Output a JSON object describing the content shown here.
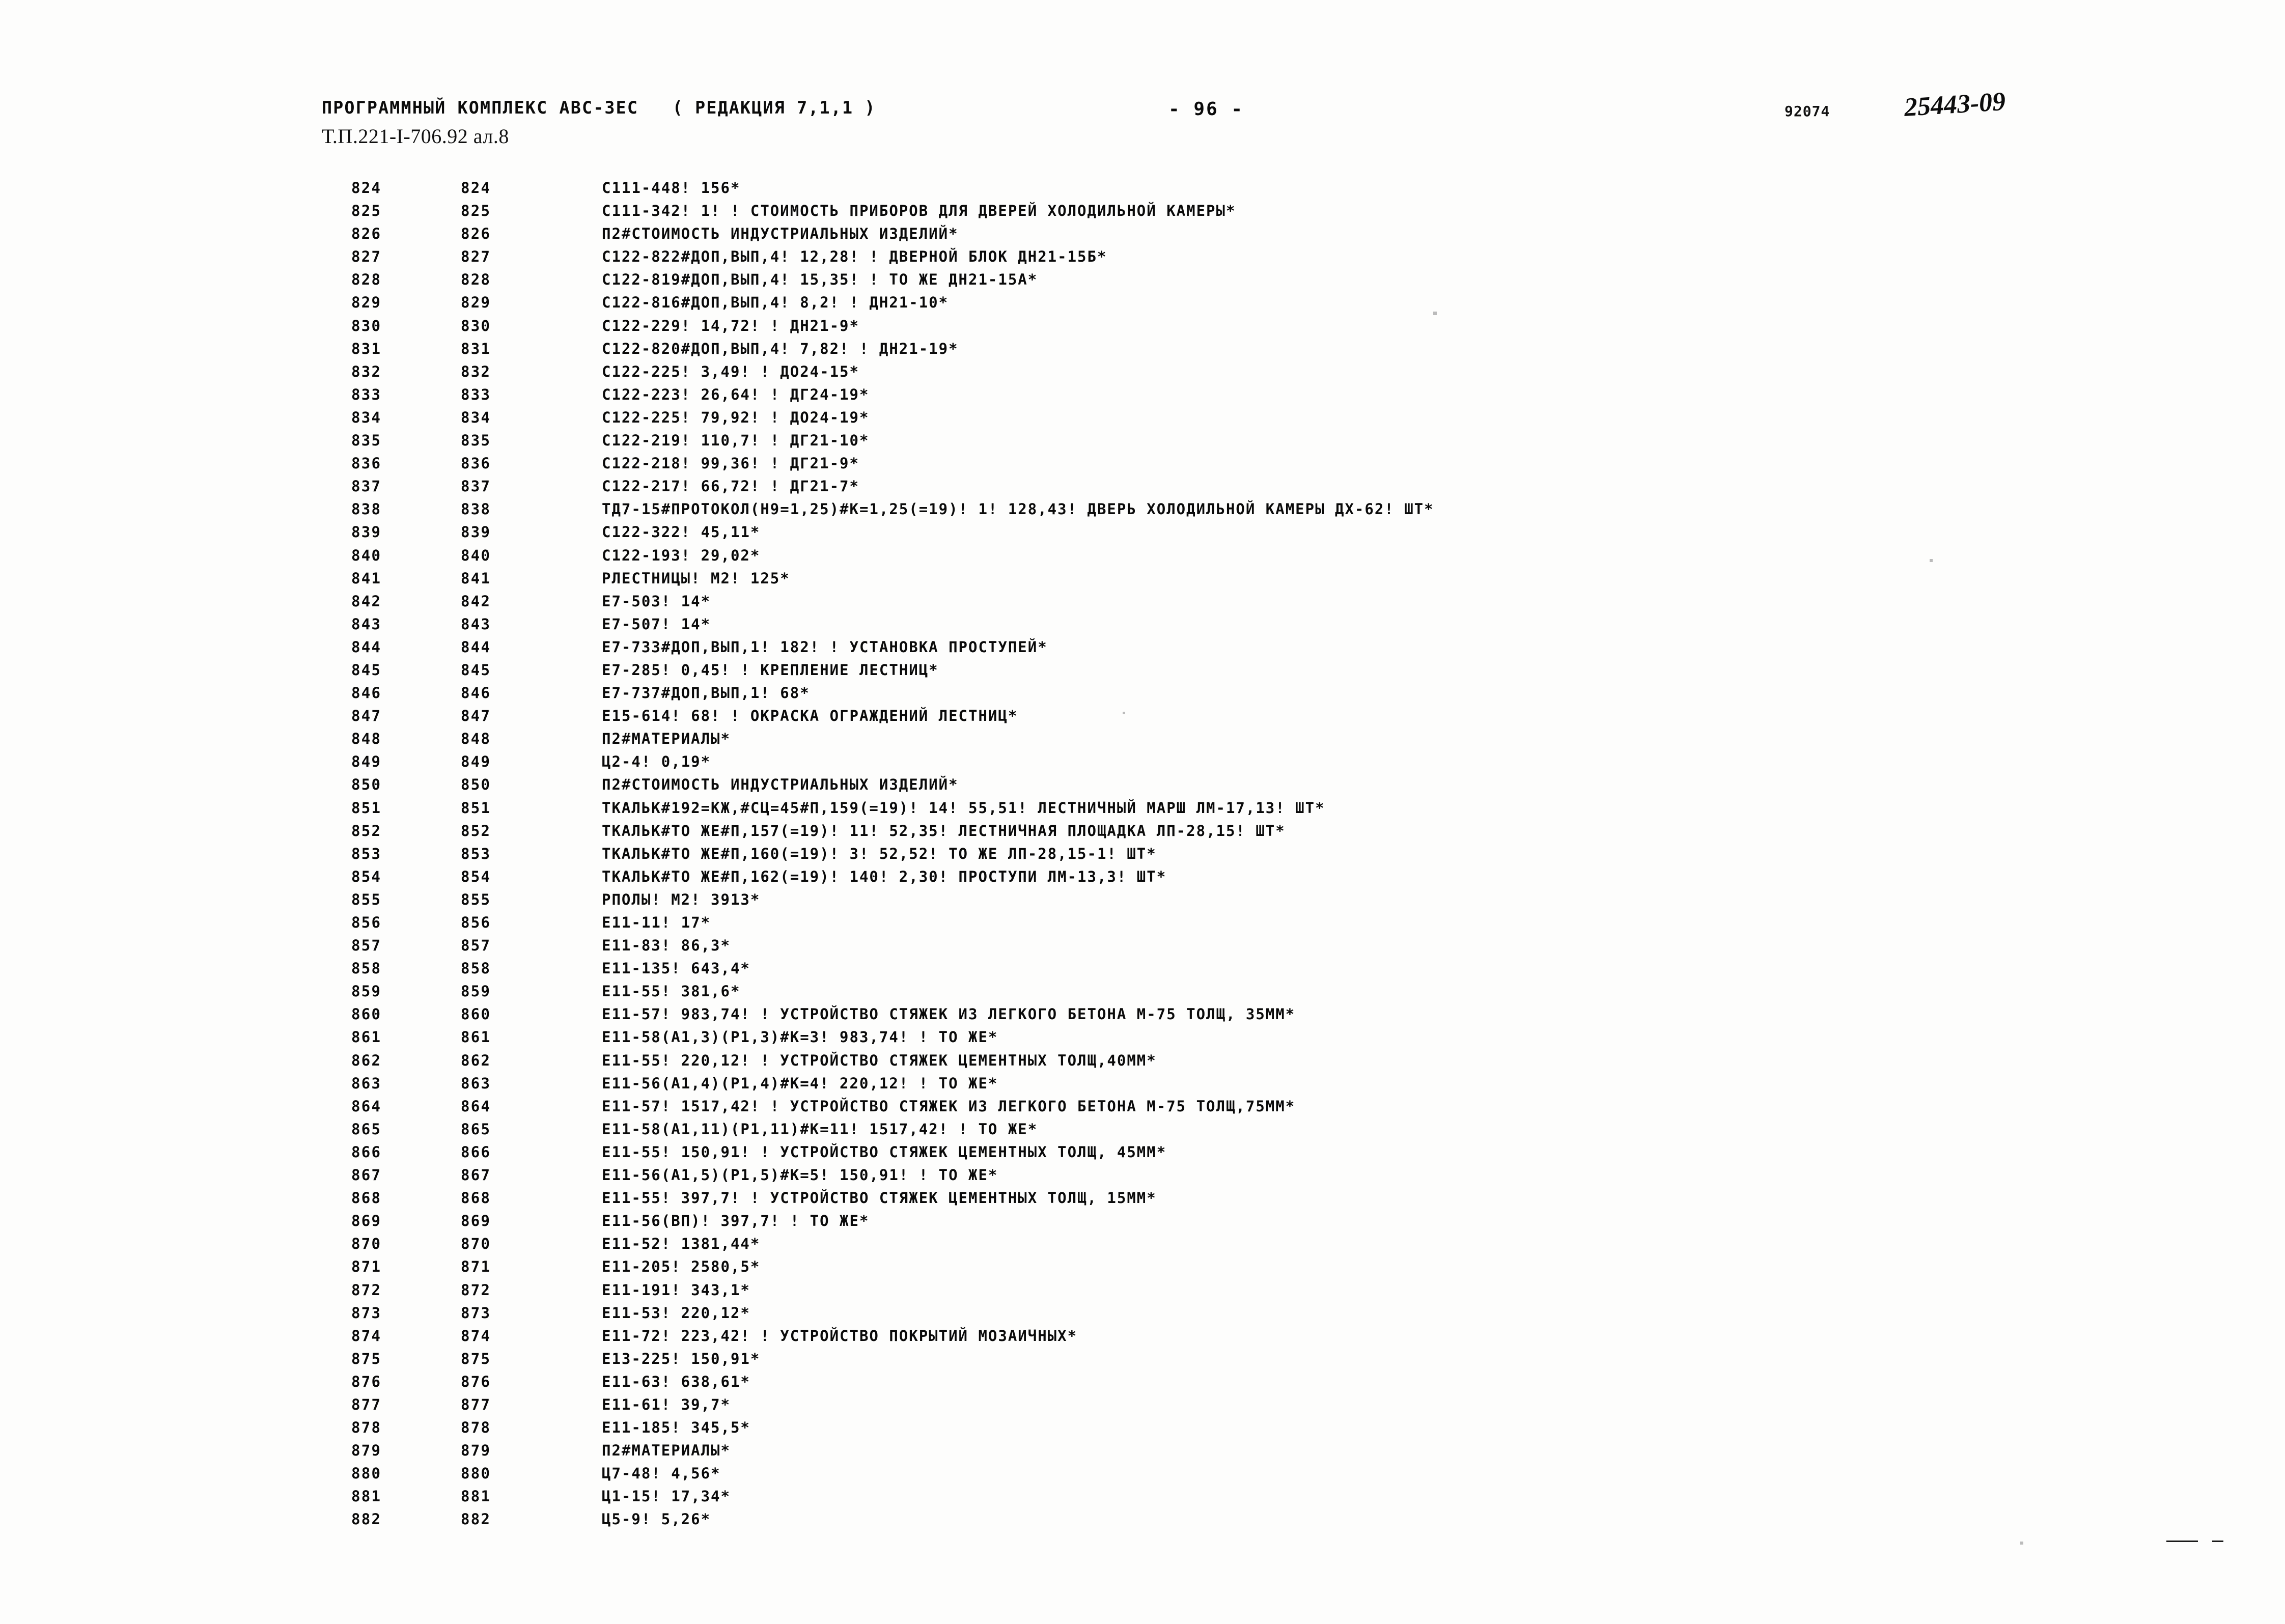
{
  "header": {
    "program_title": "ПРОГРАММНЫЙ КОМПЛЕКС АВС-ЗЕС   ( РЕДАКЦИЯ 7,1,1 )",
    "document_ref": "Т.П.221-I-706.92 ал.8",
    "page_marker": "- 96 -",
    "doc_code": "92074",
    "stamp": "25443-09"
  },
  "listing": {
    "rows": [
      {
        "a": "824",
        "b": "824",
        "text": "С111-448! 156*"
      },
      {
        "a": "825",
        "b": "825",
        "text": "С111-342! 1! ! СТОИМОСТЬ ПРИБОРОВ ДЛЯ ДВЕРЕЙ ХОЛОДИЛЬНОЙ КАМЕРЫ*"
      },
      {
        "a": "826",
        "b": "826",
        "text": "П2#СТОИМОСТЬ ИНДУСТРИАЛЬНЫХ ИЗДЕЛИЙ*"
      },
      {
        "a": "827",
        "b": "827",
        "text": "С122-822#ДОП,ВЫП,4! 12,28! ! ДВЕРНОЙ БЛОК ДН21-15Б*"
      },
      {
        "a": "828",
        "b": "828",
        "text": "С122-819#ДОП,ВЫП,4! 15,35! ! ТО ЖЕ ДН21-15А*"
      },
      {
        "a": "829",
        "b": "829",
        "text": "С122-816#ДОП,ВЫП,4! 8,2! ! ДН21-10*"
      },
      {
        "a": "830",
        "b": "830",
        "text": "С122-229! 14,72! ! ДН21-9*"
      },
      {
        "a": "831",
        "b": "831",
        "text": "С122-820#ДОП,ВЫП,4! 7,82! ! ДН21-19*"
      },
      {
        "a": "832",
        "b": "832",
        "text": "С122-225! 3,49! ! ДО24-15*"
      },
      {
        "a": "833",
        "b": "833",
        "text": "С122-223! 26,64! ! ДГ24-19*"
      },
      {
        "a": "834",
        "b": "834",
        "text": "С122-225! 79,92! ! ДО24-19*"
      },
      {
        "a": "835",
        "b": "835",
        "text": "С122-219! 110,7! ! ДГ21-10*"
      },
      {
        "a": "836",
        "b": "836",
        "text": "С122-218! 99,36! ! ДГ21-9*"
      },
      {
        "a": "837",
        "b": "837",
        "text": "С122-217! 66,72! ! ДГ21-7*"
      },
      {
        "a": "838",
        "b": "838",
        "text": "ТД7-15#ПРОТОКОЛ(Н9=1,25)#К=1,25(=19)! 1! 128,43! ДВЕРЬ ХОЛОДИЛЬНОЙ КАМЕРЫ ДХ-62! ШТ*"
      },
      {
        "a": "839",
        "b": "839",
        "text": "С122-322! 45,11*"
      },
      {
        "a": "840",
        "b": "840",
        "text": "С122-193! 29,02*"
      },
      {
        "a": "841",
        "b": "841",
        "text": "РЛЕСТНИЦЫ! М2! 125*"
      },
      {
        "a": "842",
        "b": "842",
        "text": "Е7-503! 14*"
      },
      {
        "a": "843",
        "b": "843",
        "text": "Е7-507! 14*"
      },
      {
        "a": "844",
        "b": "844",
        "text": "Е7-733#ДОП,ВЫП,1! 182! ! УСТАНОВКА ПРОСТУПЕЙ*"
      },
      {
        "a": "845",
        "b": "845",
        "text": "Е7-285! 0,45! ! КРЕПЛЕНИЕ ЛЕСТНИЦ*"
      },
      {
        "a": "846",
        "b": "846",
        "text": "Е7-737#ДОП,ВЫП,1! 68*"
      },
      {
        "a": "847",
        "b": "847",
        "text": "Е15-614! 68! ! ОКРАСКА ОГРАЖДЕНИЙ ЛЕСТНИЦ*"
      },
      {
        "a": "848",
        "b": "848",
        "text": "П2#МАТЕРИАЛЫ*"
      },
      {
        "a": "849",
        "b": "849",
        "text": "Ц2-4! 0,19*"
      },
      {
        "a": "850",
        "b": "850",
        "text": "П2#СТОИМОСТЬ ИНДУСТРИАЛЬНЫХ ИЗДЕЛИЙ*"
      },
      {
        "a": "851",
        "b": "851",
        "text": "ТКАЛЬК#192=КЖ,#СЦ=45#П,159(=19)! 14! 55,51! ЛЕСТНИЧНЫЙ МАРШ ЛМ-17,13! ШТ*"
      },
      {
        "a": "852",
        "b": "852",
        "text": "ТКАЛЬК#ТО ЖЕ#П,157(=19)! 11! 52,35! ЛЕСТНИЧНАЯ ПЛОЩАДКА ЛП-28,15! ШТ*"
      },
      {
        "a": "853",
        "b": "853",
        "text": "ТКАЛЬК#ТО ЖЕ#П,160(=19)! 3! 52,52! ТО ЖЕ ЛП-28,15-1! ШТ*"
      },
      {
        "a": "854",
        "b": "854",
        "text": "ТКАЛЬК#ТО ЖЕ#П,162(=19)! 140! 2,30! ПРОСТУПИ ЛМ-13,3! ШТ*"
      },
      {
        "a": "855",
        "b": "855",
        "text": "РПОЛЫ! М2! 3913*"
      },
      {
        "a": "856",
        "b": "856",
        "text": "Е11-11! 17*"
      },
      {
        "a": "857",
        "b": "857",
        "text": "Е11-83! 86,3*"
      },
      {
        "a": "858",
        "b": "858",
        "text": "Е11-135! 643,4*"
      },
      {
        "a": "859",
        "b": "859",
        "text": "Е11-55! 381,6*"
      },
      {
        "a": "860",
        "b": "860",
        "text": "Е11-57! 983,74! ! УСТРОЙСТВО СТЯЖЕК ИЗ ЛЕГКОГО БЕТОНА М-75 ТОЛЩ, 35ММ*"
      },
      {
        "a": "861",
        "b": "861",
        "text": "Е11-58(А1,3)(Р1,3)#К=3! 983,74! ! ТО ЖЕ*"
      },
      {
        "a": "862",
        "b": "862",
        "text": "Е11-55! 220,12! ! УСТРОЙСТВО СТЯЖЕК ЦЕМЕНТНЫХ ТОЛЩ,40ММ*"
      },
      {
        "a": "863",
        "b": "863",
        "text": "Е11-56(А1,4)(Р1,4)#К=4! 220,12! ! ТО ЖЕ*"
      },
      {
        "a": "864",
        "b": "864",
        "text": "Е11-57! 1517,42! ! УСТРОЙСТВО СТЯЖЕК ИЗ ЛЕГКОГО БЕТОНА М-75 ТОЛЩ,75ММ*"
      },
      {
        "a": "865",
        "b": "865",
        "text": "Е11-58(А1,11)(Р1,11)#К=11! 1517,42! ! ТО ЖЕ*"
      },
      {
        "a": "866",
        "b": "866",
        "text": "Е11-55! 150,91! ! УСТРОЙСТВО СТЯЖЕК ЦЕМЕНТНЫХ ТОЛЩ, 45ММ*"
      },
      {
        "a": "867",
        "b": "867",
        "text": "Е11-56(А1,5)(Р1,5)#К=5! 150,91! ! ТО ЖЕ*"
      },
      {
        "a": "868",
        "b": "868",
        "text": "Е11-55! 397,7! ! УСТРОЙСТВО СТЯЖЕК ЦЕМЕНТНЫХ ТОЛЩ, 15ММ*"
      },
      {
        "a": "869",
        "b": "869",
        "text": "Е11-56(ВП)! 397,7! ! ТО ЖЕ*"
      },
      {
        "a": "870",
        "b": "870",
        "text": "Е11-52! 1381,44*"
      },
      {
        "a": "871",
        "b": "871",
        "text": "Е11-205! 2580,5*"
      },
      {
        "a": "872",
        "b": "872",
        "text": "Е11-191! 343,1*"
      },
      {
        "a": "873",
        "b": "873",
        "text": "Е11-53! 220,12*"
      },
      {
        "a": "874",
        "b": "874",
        "text": "Е11-72! 223,42! ! УСТРОЙСТВО ПОКРЫТИЙ МОЗАИЧНЫХ*"
      },
      {
        "a": "875",
        "b": "875",
        "text": "Е13-225! 150,91*"
      },
      {
        "a": "876",
        "b": "876",
        "text": "Е11-63! 638,61*"
      },
      {
        "a": "877",
        "b": "877",
        "text": "Е11-61! 39,7*"
      },
      {
        "a": "878",
        "b": "878",
        "text": "Е11-185! 345,5*"
      },
      {
        "a": "879",
        "b": "879",
        "text": "П2#МАТЕРИАЛЫ*"
      },
      {
        "a": "880",
        "b": "880",
        "text": "Ц7-48! 4,56*"
      },
      {
        "a": "881",
        "b": "881",
        "text": "Ц1-15! 17,34*"
      },
      {
        "a": "882",
        "b": "882",
        "text": "Ц5-9! 5,26*"
      }
    ]
  }
}
